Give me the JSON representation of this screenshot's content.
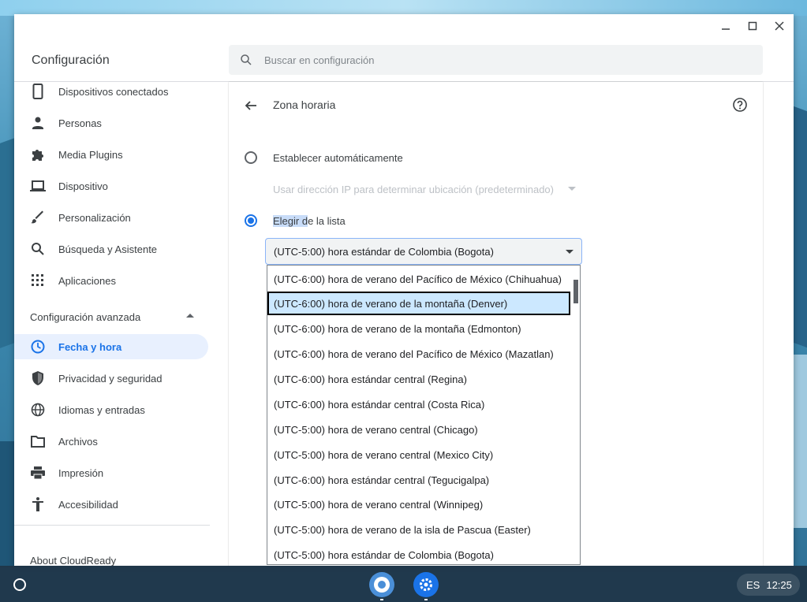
{
  "window": {
    "title": "Configuración",
    "controls": [
      "minimize-icon",
      "maximize-icon",
      "close-icon"
    ]
  },
  "search": {
    "placeholder": "Buscar en configuración",
    "value": ""
  },
  "sidebar": {
    "items": [
      {
        "label": "Dispositivos conectados",
        "icon": "phone-icon"
      },
      {
        "label": "Personas",
        "icon": "person-icon"
      },
      {
        "label": "Media Plugins",
        "icon": "puzzle-icon"
      },
      {
        "label": "Dispositivo",
        "icon": "laptop-icon"
      },
      {
        "label": "Personalización",
        "icon": "brush-icon"
      },
      {
        "label": "Búsqueda y Asistente",
        "icon": "search-icon"
      },
      {
        "label": "Aplicaciones",
        "icon": "apps-grid-icon"
      }
    ],
    "advanced_label": "Configuración avanzada",
    "advanced_items": [
      {
        "label": "Fecha y hora",
        "icon": "clock-icon",
        "active": true
      },
      {
        "label": "Privacidad y seguridad",
        "icon": "shield-icon"
      },
      {
        "label": "Idiomas y entradas",
        "icon": "globe-icon"
      },
      {
        "label": "Archivos",
        "icon": "folder-icon"
      },
      {
        "label": "Impresión",
        "icon": "printer-icon"
      },
      {
        "label": "Accesibilidad",
        "icon": "accessibility-icon"
      }
    ],
    "about_label": "About CloudReady"
  },
  "main": {
    "page_title": "Zona horaria",
    "option_auto_label": "Establecer automáticamente",
    "auto_method_value": "Usar dirección IP para determinar ubicación (predeterminado)",
    "option_list_label_highlight": "Elegir d",
    "option_list_label_rest": "e la lista",
    "selected_option": "list",
    "timezone_value": "(UTC-5:00) hora estándar de Colombia (Bogota)",
    "timezone_options": [
      "(UTC-6:00) hora de verano del Pacífico de México (Chihuahua)",
      "(UTC-6:00) hora de verano de la montaña (Denver)",
      "(UTC-6:00) hora de verano de la montaña (Edmonton)",
      "(UTC-6:00) hora de verano del Pacífico de México (Mazatlan)",
      "(UTC-6:00) hora estándar central (Regina)",
      "(UTC-6:00) hora estándar central (Costa Rica)",
      "(UTC-5:00) hora de verano central (Chicago)",
      "(UTC-5:00) hora de verano central (Mexico City)",
      "(UTC-6:00) hora estándar central (Tegucigalpa)",
      "(UTC-5:00) hora de verano central (Winnipeg)",
      "(UTC-5:00) hora de verano de la isla de Pascua (Easter)",
      "(UTC-5:00) hora estándar de Colombia (Bogota)"
    ],
    "highlighted_option_index": 1
  },
  "taskbar": {
    "apps": [
      "chrome-icon",
      "settings-gear-icon"
    ],
    "language": "ES",
    "time": "12:25"
  },
  "colors": {
    "accent": "#1a73e8",
    "active_nav_bg": "#e8f0fe",
    "highlight_option_bg": "#cce8ff"
  }
}
